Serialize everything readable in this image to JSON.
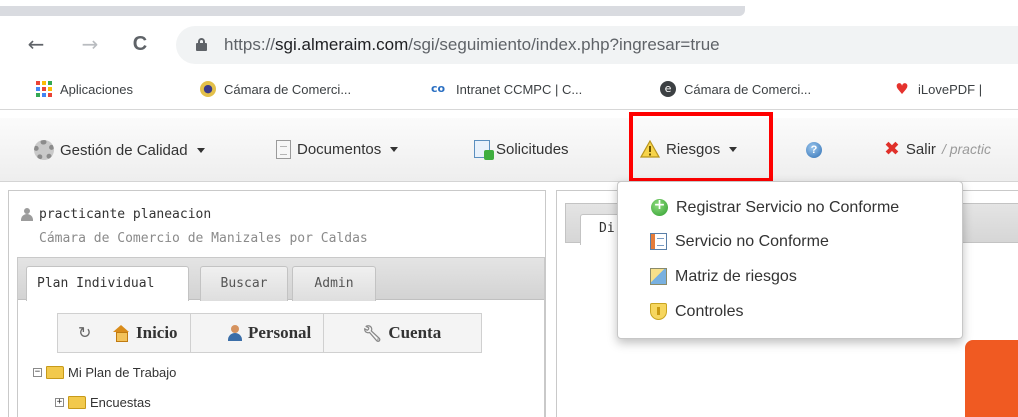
{
  "browser": {
    "nav": {
      "back": "←",
      "forward": "→",
      "reload": "C"
    },
    "url_prefix": "https://",
    "url_host": "sgi.almeraim.com",
    "url_path": "/sgi/seguimiento/index.php?ingresar=true",
    "bookmarks": [
      {
        "label": "Aplicaciones",
        "icon": "apps-grid-icon"
      },
      {
        "label": "Cámara de Comerci...",
        "icon": "chamber-icon"
      },
      {
        "label": "Intranet CCMPC | C...",
        "icon": "intranet-icon"
      },
      {
        "label": "Cámara de Comerci...",
        "icon": "e-icon"
      },
      {
        "label": "iLovePDF |",
        "icon": "heart-icon"
      }
    ]
  },
  "toolbar": {
    "calidad": "Gestión de Calidad",
    "documentos": "Documentos",
    "solicitudes": "Solicitudes",
    "riesgos": "Riesgos",
    "salir": "Salir",
    "salir_suffix": "/ practic"
  },
  "riesgos_menu": {
    "items": [
      {
        "label": "Registrar Servicio no Conforme",
        "icon": "add-circle-icon"
      },
      {
        "label": "Servicio no Conforme",
        "icon": "form-icon"
      },
      {
        "label": "Matriz de riesgos",
        "icon": "matrix-icon"
      },
      {
        "label": "Controles",
        "icon": "shield-icon"
      }
    ]
  },
  "user": {
    "name": "practicante planeacion",
    "org": "Cámara de Comercio de Manizales por Caldas"
  },
  "left_tabs": [
    "Plan Individual",
    "Buscar",
    "Admin"
  ],
  "quick": {
    "home": "Inicio",
    "personal": "Personal",
    "cuenta": "Cuenta"
  },
  "tree": [
    {
      "label": "Mi Plan de Trabajo",
      "toggle": "−"
    },
    {
      "label": "Encuestas",
      "toggle": "+"
    }
  ],
  "right_tab": "Di",
  "colors": {
    "highlight": "#ff0000",
    "accent_orange": "#f05a22"
  }
}
